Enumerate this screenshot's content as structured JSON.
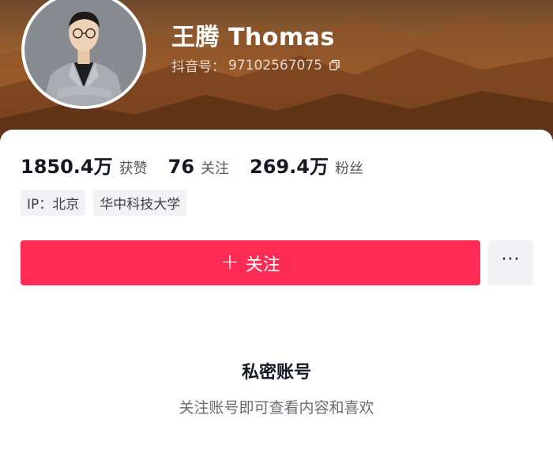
{
  "profile": {
    "nickname": "王腾 Thomas",
    "douyin_id_label": "抖音号：",
    "douyin_id": "97102567075"
  },
  "stats": [
    {
      "value": "1850.4万",
      "label": "获赞"
    },
    {
      "value": "76",
      "label": "关注"
    },
    {
      "value": "269.4万",
      "label": "粉丝"
    }
  ],
  "tags": [
    "IP：北京",
    "华中科技大学"
  ],
  "actions": {
    "follow_label": "关注",
    "plus_glyph": "+",
    "more_glyph": "···"
  },
  "private_notice": {
    "title": "私密账号",
    "description": "关注账号即可查看内容和喜欢"
  },
  "colors": {
    "accent": "#fe2c55",
    "banner": "#8e5a30"
  }
}
